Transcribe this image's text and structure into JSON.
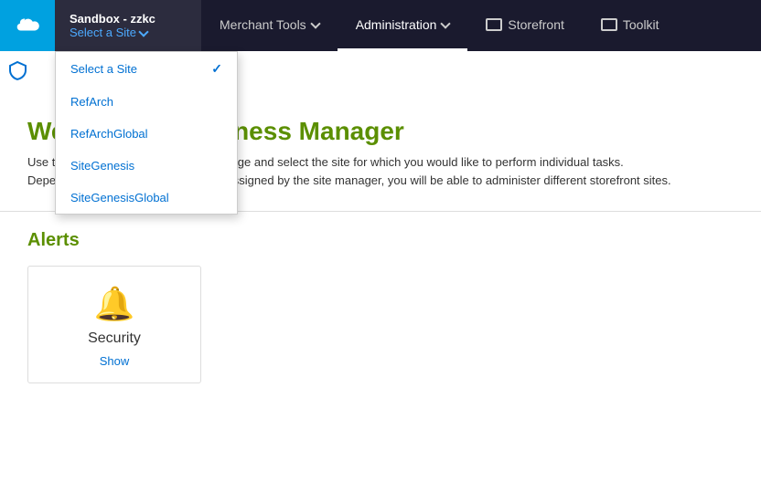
{
  "topbar": {
    "sandbox_name": "Sandbox - zzkc",
    "select_site_label": "Select a Site",
    "nav_items": [
      {
        "id": "merchant-tools",
        "label": "Merchant Tools",
        "has_dropdown": true,
        "has_icon": false
      },
      {
        "id": "administration",
        "label": "Administration",
        "has_dropdown": true,
        "has_icon": false,
        "active": true
      },
      {
        "id": "storefront",
        "label": "Storefront",
        "has_dropdown": false,
        "has_icon": true
      },
      {
        "id": "toolkit",
        "label": "Toolkit",
        "has_dropdown": false,
        "has_icon": true
      }
    ]
  },
  "site_dropdown": {
    "items": [
      {
        "id": "select-a-site",
        "label": "Select a Site",
        "selected": true
      },
      {
        "id": "refarch",
        "label": "RefArch",
        "selected": false
      },
      {
        "id": "refarchglobal",
        "label": "RefArchGlobal",
        "selected": false
      },
      {
        "id": "sitegenesis",
        "label": "SiteGenesis",
        "selected": false
      },
      {
        "id": "sitegenesiglobal",
        "label": "SiteGenesisGlobal",
        "selected": false
      }
    ]
  },
  "welcome": {
    "title": "Welcome to Business Manager",
    "desc_line1": "Use the site selector at the top of the page and select the site for which you would like to perform individual tasks.",
    "desc_line2": "Depending on which roles have been assigned by the site manager, you will be able to administer different storefront sites."
  },
  "alerts": {
    "title": "Alerts",
    "card": {
      "label": "Security",
      "show_link": "Show"
    }
  }
}
